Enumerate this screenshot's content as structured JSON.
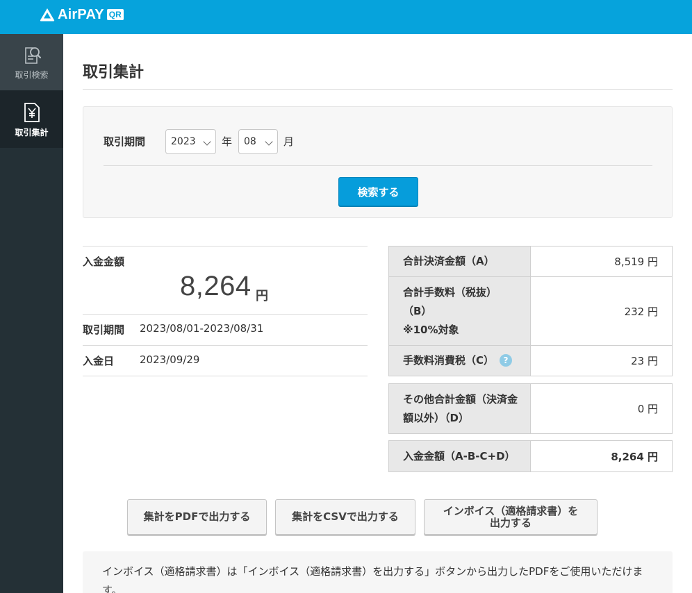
{
  "header": {
    "logo_text": "AirPAY",
    "logo_badge": "QR",
    "brand_color": "#06a3dc"
  },
  "sidebar": {
    "items": [
      {
        "label": "取引検索",
        "icon": "document-search-icon",
        "active": false
      },
      {
        "label": "取引集計",
        "icon": "yen-document-icon",
        "active": true
      }
    ]
  },
  "page": {
    "title": "取引集計"
  },
  "search": {
    "period_label": "取引期間",
    "year_value": "2023",
    "year_unit": "年",
    "month_value": "08",
    "month_unit": "月",
    "button_label": "検索する"
  },
  "summary": {
    "deposit_label": "入金金額",
    "deposit_amount": "8,264",
    "deposit_unit": "円",
    "period_label": "取引期間",
    "period_value": "2023/08/01-2023/08/31",
    "date_label": "入金日",
    "date_value": "2023/09/29"
  },
  "breakdown": {
    "total_payment_label": "合計決済金額（A）",
    "total_payment_value": "8,519 円",
    "fee_label_1": "合計手数料（税抜）",
    "fee_label_2": "（B）",
    "fee_label_3": "※10%対象",
    "fee_value": "232 円",
    "tax_label": "手数料消費税（C）",
    "tax_help": "?",
    "tax_value": "23 円",
    "other_label_1": "その他合計金額（決済金",
    "other_label_2": "額以外）（D）",
    "other_value": "0 円",
    "deposit_label": "入金金額（A-B-C+D）",
    "deposit_value": "8,264 円"
  },
  "exports": {
    "pdf_label": "集計をPDFで出力する",
    "csv_label": "集計をCSVで出力する",
    "invoice_label_1": "インボイス（適格請求書）を",
    "invoice_label_2": "出力する"
  },
  "notice": {
    "text": "インボイス（適格請求書）は「インボイス（適格請求書）を出力する」ボタンから出力したPDFをご使用いただけます。"
  }
}
